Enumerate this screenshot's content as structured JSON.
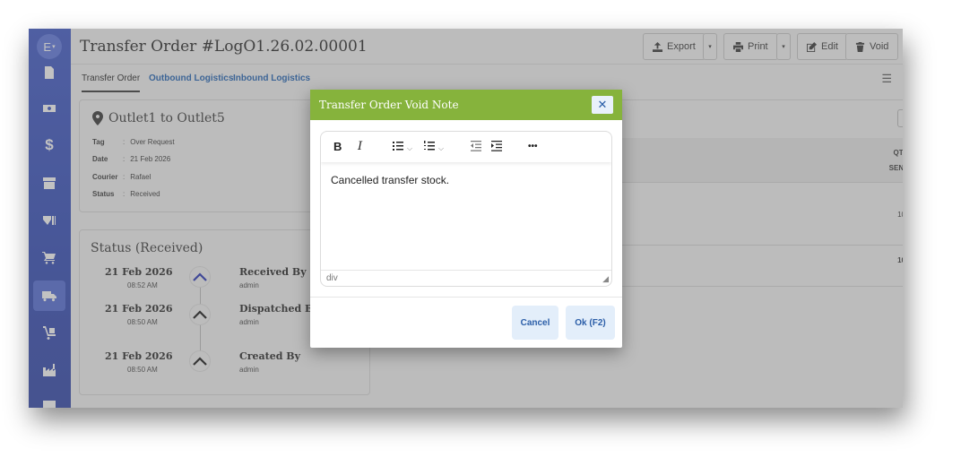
{
  "user": {
    "initial": "E",
    "caret": "▾"
  },
  "page": {
    "title": "Transfer Order #LogO1.26.02.00001"
  },
  "toolbar": {
    "export_label": "Export",
    "print_label": "Print",
    "edit_label": "Edit",
    "void_label": "Void",
    "split_caret": "▾"
  },
  "tabs": [
    {
      "label": "Transfer Order",
      "active": true
    },
    {
      "label": "Outbound Logistics",
      "active": false
    },
    {
      "label": "Inbound Logistics",
      "active": false
    }
  ],
  "menu_glyph": "☰",
  "info_card": {
    "title": "Outlet1 to Outlet5",
    "fields": [
      {
        "key": "Tag",
        "value": "Over Request"
      },
      {
        "key": "Date",
        "value": "21 Feb 2026"
      },
      {
        "key": "Courier",
        "value": "Rafael"
      },
      {
        "key": "Status",
        "value": "Received"
      }
    ],
    "separator": ":"
  },
  "status_card": {
    "title": "Status (Received)",
    "timeline": [
      {
        "date": "21 Feb 2026",
        "time": "08:52 AM",
        "label": "Received By",
        "user": "admin"
      },
      {
        "date": "21 Feb 2026",
        "time": "08:50 AM",
        "label": "Dispatched By",
        "user": "admin"
      },
      {
        "date": "21 Feb 2026",
        "time": "08:50 AM",
        "label": "Created By",
        "user": "admin"
      }
    ]
  },
  "right_table": {
    "header_line1": "QTY",
    "header_line2": "SENT",
    "row_value": "10",
    "total_value": "10",
    "dropdown_caret": "▾"
  },
  "modal": {
    "title": "Transfer Order Void Note",
    "close_glyph": "✕",
    "editor_text": "Cancelled transfer stock.",
    "path": "div",
    "grip": "◢",
    "tools": {
      "bold": "B",
      "italic": "I",
      "more": "•••",
      "chev": "⌵"
    },
    "cancel_label": "Cancel",
    "ok_label": "Ok (F2)"
  },
  "colors": {
    "sidebar": "#2c46b6",
    "modal_header": "#86b33c",
    "link": "#1a5fb4",
    "button_bg": "#e3eefa",
    "button_text": "#2b5ea8"
  }
}
